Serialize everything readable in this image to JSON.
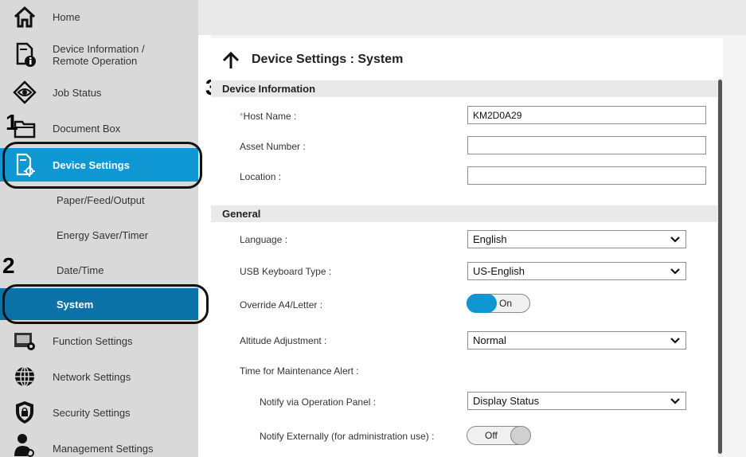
{
  "sidebar": {
    "items": [
      {
        "label": "Home",
        "icon": "home-icon"
      },
      {
        "label": "Device Information /",
        "label2": "Remote Operation",
        "icon": "device-info-icon"
      },
      {
        "label": "Job Status",
        "icon": "eye-icon"
      },
      {
        "label": "Document Box",
        "icon": "folder-icon"
      },
      {
        "label": "Device Settings",
        "icon": "device-settings-icon"
      },
      {
        "label": "Paper/Feed/Output"
      },
      {
        "label": "Energy Saver/Timer"
      },
      {
        "label": "Date/Time"
      },
      {
        "label": "System"
      },
      {
        "label": "Function Settings",
        "icon": "function-settings-icon"
      },
      {
        "label": "Network Settings",
        "icon": "globe-icon"
      },
      {
        "label": "Security Settings",
        "icon": "shield-icon"
      },
      {
        "label": "Management Settings",
        "icon": "person-gear-icon"
      }
    ],
    "selected_color": "#0e97d2",
    "selected_sub_color": "#0b72a7"
  },
  "callouts": [
    "1",
    "2",
    "3"
  ],
  "main": {
    "title": "Device Settings : System",
    "sections": {
      "device_information": "Device Information",
      "general": "General"
    },
    "fields": {
      "host_name": {
        "required_mark": "*",
        "label": "Host Name :",
        "value": "KM2D0A29"
      },
      "asset_number": {
        "label": "Asset Number :",
        "value": ""
      },
      "location": {
        "label": "Location :",
        "value": ""
      },
      "language": {
        "label": "Language :",
        "value": "English"
      },
      "usb_keyboard": {
        "label": "USB Keyboard Type :",
        "value": "US-English"
      },
      "override": {
        "label": "Override A4/Letter :",
        "value": "On"
      },
      "altitude": {
        "label": "Altitude Adjustment :",
        "value": "Normal"
      },
      "maintenance": {
        "label": "Time for Maintenance Alert :"
      },
      "notify_panel": {
        "label": "Notify via Operation Panel :",
        "value": "Display Status"
      },
      "notify_external": {
        "label": "Notify Externally (for administration use) :",
        "value": "Off"
      }
    },
    "accent_color": "#0e97d2"
  }
}
